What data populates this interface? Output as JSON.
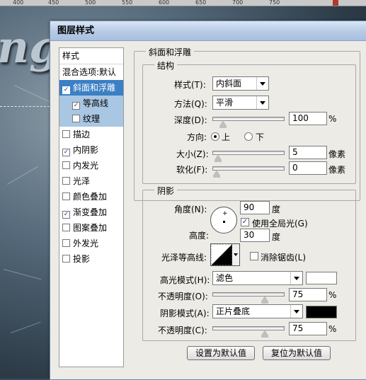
{
  "ruler": {
    "ticks": [
      "400",
      "450",
      "500",
      "550",
      "600",
      "650",
      "700",
      "750"
    ]
  },
  "dialog": {
    "title": "图层样式",
    "left_panel": {
      "header": "样式",
      "items": [
        {
          "label": "混合选项:默认",
          "checkbox": false,
          "checked": false
        },
        {
          "label": "斜面和浮雕",
          "checkbox": true,
          "checked": true
        },
        {
          "label": "等高线",
          "checkbox": true,
          "checked": true
        },
        {
          "label": "纹理",
          "checkbox": true,
          "checked": false
        },
        {
          "label": "描边",
          "checkbox": true,
          "checked": false
        },
        {
          "label": "内阴影",
          "checkbox": true,
          "checked": true
        },
        {
          "label": "内发光",
          "checkbox": true,
          "checked": false
        },
        {
          "label": "光泽",
          "checkbox": true,
          "checked": false
        },
        {
          "label": "颜色叠加",
          "checkbox": true,
          "checked": false
        },
        {
          "label": "渐变叠加",
          "checkbox": true,
          "checked": true
        },
        {
          "label": "图案叠加",
          "checkbox": true,
          "checked": false
        },
        {
          "label": "外发光",
          "checkbox": true,
          "checked": false
        },
        {
          "label": "投影",
          "checkbox": true,
          "checked": false
        }
      ]
    },
    "bevel": {
      "group_title": "斜面和浮雕",
      "structure_title": "结构",
      "style_label": "样式(T):",
      "style_value": "内斜面",
      "method_label": "方法(Q):",
      "method_value": "平滑",
      "depth_label": "深度(D):",
      "depth_value": "100",
      "depth_unit": "%",
      "depth_level": 0.1,
      "direction_label": "方向:",
      "direction_up": "上",
      "direction_down": "下",
      "size_label": "大小(Z):",
      "size_value": "5",
      "size_unit": "像素",
      "size_level": 0.02,
      "soften_label": "软化(F):",
      "soften_value": "0",
      "soften_unit": "像素",
      "soften_level": 0
    },
    "shading": {
      "group_title": "阴影",
      "angle_label": "角度(N):",
      "angle_value": "90",
      "angle_unit": "度",
      "global_light_label": "使用全局光(G)",
      "global_light_checked": true,
      "altitude_label": "高度:",
      "altitude_value": "30",
      "altitude_unit": "度",
      "gloss_label": "光泽等高线:",
      "antialias_label": "消除锯齿(L)",
      "antialias_checked": false,
      "highlight_label": "高光模式(H):",
      "highlight_mode": "滤色",
      "highlight_color": "#ffffff",
      "highlight_opacity_label": "不透明度(O):",
      "highlight_opacity": "75",
      "highlight_opacity_unit": "%",
      "highlight_opacity_level": 0.75,
      "shadow_label": "阴影模式(A):",
      "shadow_mode": "正片叠底",
      "shadow_color": "#000000",
      "shadow_opacity_label": "不透明度(C):",
      "shadow_opacity": "75",
      "shadow_opacity_unit": "%",
      "shadow_opacity_level": 0.75
    },
    "buttons": {
      "set_default": "设置为默认值",
      "reset_default": "复位为默认值"
    }
  }
}
